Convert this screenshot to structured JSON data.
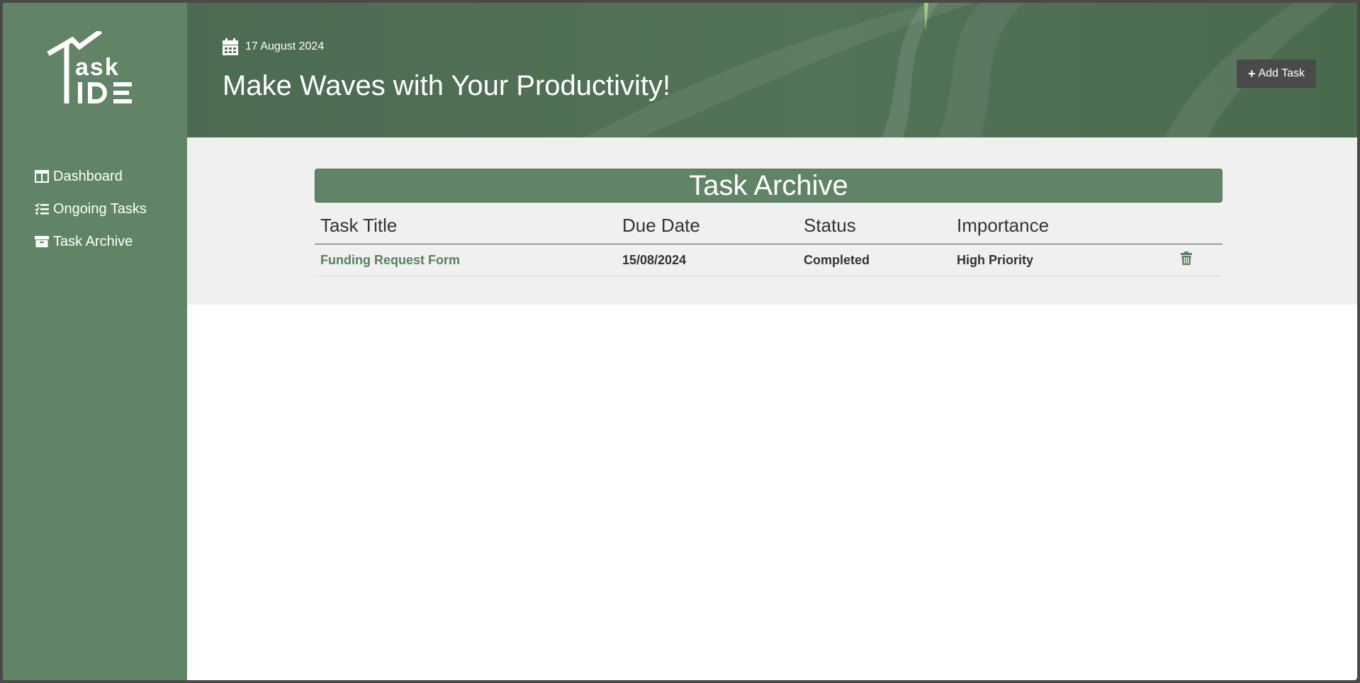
{
  "brand": {
    "logo_text": "Task TIDE"
  },
  "sidebar": {
    "items": [
      {
        "label": "Dashboard",
        "icon": "dashboard-icon"
      },
      {
        "label": "Ongoing Tasks",
        "icon": "list-check-icon"
      },
      {
        "label": "Task Archive",
        "icon": "archive-box-icon"
      }
    ]
  },
  "header": {
    "date": "17 August 2024",
    "headline": "Make Waves with Your Productivity!",
    "add_task_label": "Add Task"
  },
  "archive": {
    "title": "Task Archive",
    "columns": [
      "Task Title",
      "Due Date",
      "Status",
      "Importance"
    ],
    "rows": [
      {
        "title": "Funding Request Form",
        "due_date": "15/08/2024",
        "status": "Completed",
        "importance": "High Priority"
      }
    ]
  },
  "colors": {
    "sidebar": "#628466",
    "accent_link": "#5b7f5f",
    "add_button": "#4a4a4a",
    "content_bg": "#f0f0f0"
  }
}
